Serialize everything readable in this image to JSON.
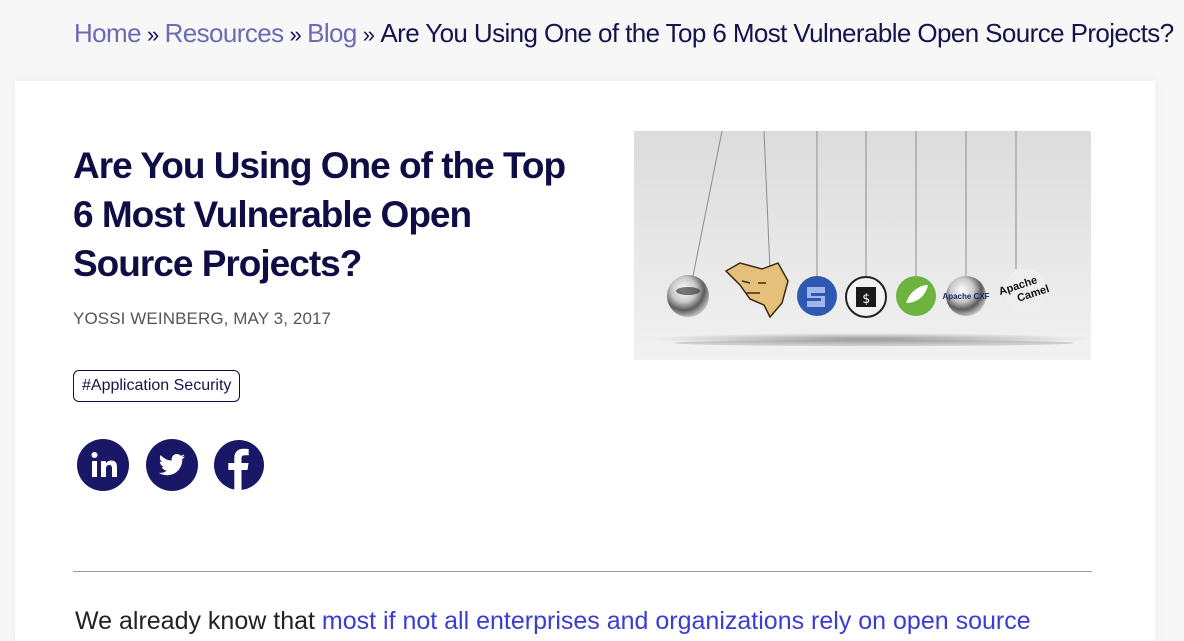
{
  "breadcrumb": {
    "items": [
      {
        "label": "Home"
      },
      {
        "label": "Resources"
      },
      {
        "label": "Blog"
      }
    ],
    "separator": "»",
    "current": "Are You Using One of the Top 6 Most Vulnerable Open Source Projects?"
  },
  "article": {
    "title": "Are You Using One of the Top 6 Most Vulnerable Open Source Projects?",
    "byline": "YOSSI WEINBERG, MAY 3, 2017",
    "tag": "#Application Security",
    "intro_text": "We already know that ",
    "intro_link": "most if not all enterprises and organizations rely on open source"
  },
  "social": [
    {
      "icon": "linkedin-icon",
      "label": "in"
    },
    {
      "icon": "twitter-icon",
      "label": ""
    },
    {
      "icon": "facebook-icon",
      "label": "f"
    }
  ],
  "hero_image": {
    "labels": {
      "apache_cxf": "Apache CXF",
      "apache": "Apache",
      "camel": "Camel"
    }
  },
  "colors": {
    "brand_navy": "#181866",
    "link": "#3b3bd6",
    "breadcrumb_link": "#6b6bb3"
  }
}
